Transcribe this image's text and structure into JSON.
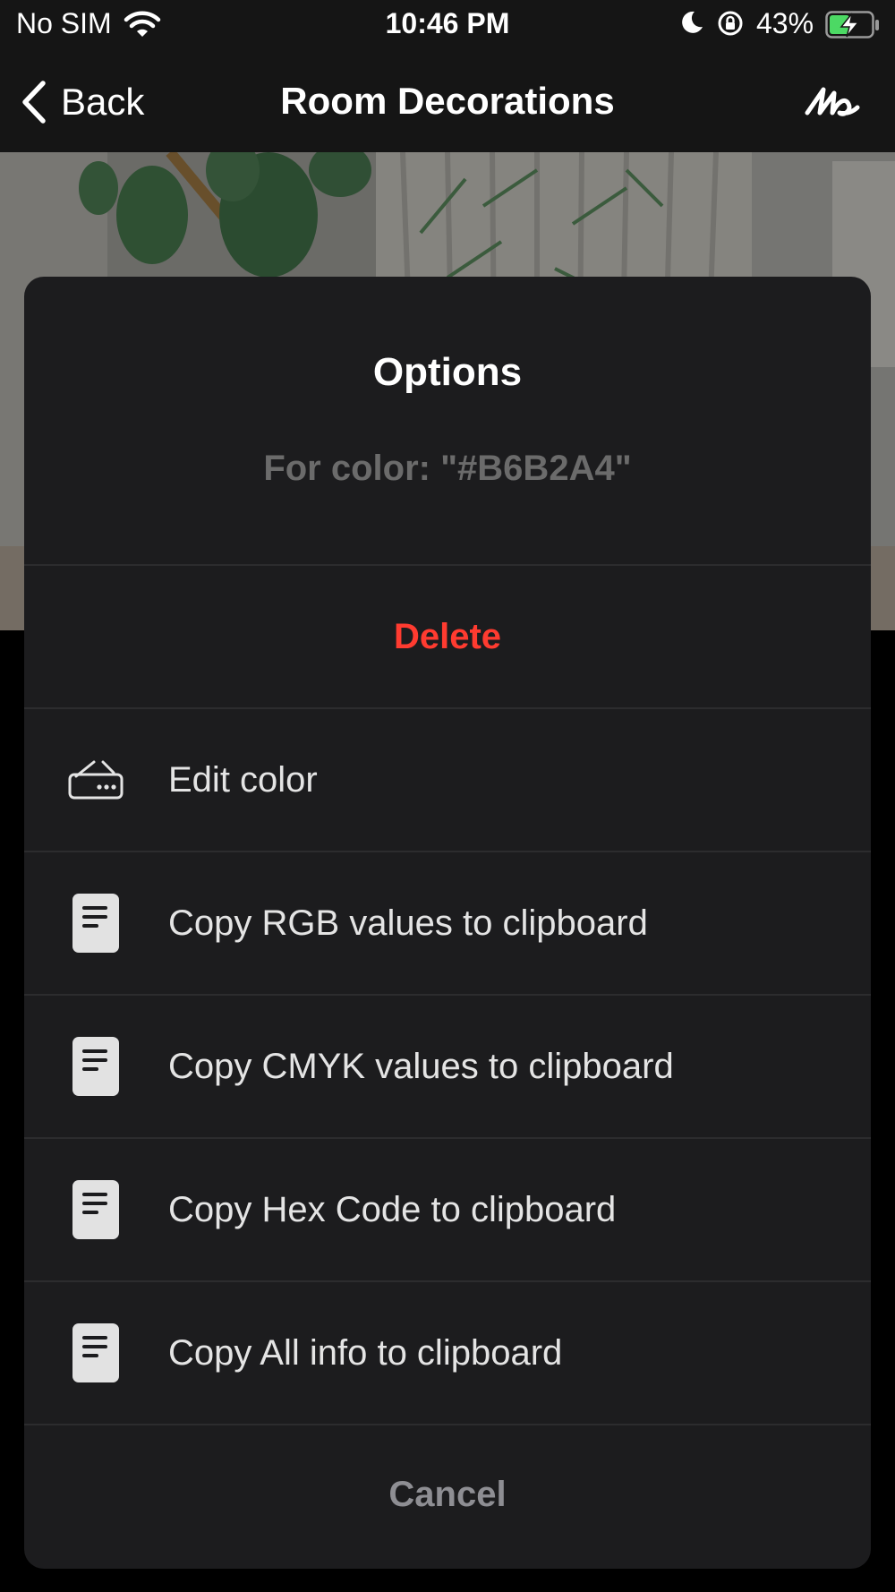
{
  "status_bar": {
    "carrier": "No SIM",
    "time": "10:46 PM",
    "battery_percent": "43%",
    "icons": [
      "wifi-icon",
      "moon-icon",
      "rotation-lock-icon",
      "battery-charging-icon"
    ]
  },
  "nav": {
    "back_label": "Back",
    "title": "Room Decorations",
    "right_icon": "signature-icon"
  },
  "sheet": {
    "title": "Options",
    "subtitle": "For color: \"#B6B2A4\"",
    "delete_label": "Delete",
    "items": [
      {
        "icon": "edit-color-icon",
        "label": "Edit color"
      },
      {
        "icon": "document-icon",
        "label": "Copy RGB values to clipboard"
      },
      {
        "icon": "document-icon",
        "label": "Copy CMYK values to clipboard"
      },
      {
        "icon": "document-icon",
        "label": "Copy Hex Code to clipboard"
      },
      {
        "icon": "document-icon",
        "label": "Copy All info to clipboard"
      }
    ],
    "cancel_label": "Cancel"
  },
  "colors": {
    "destructive": "#FF3B30",
    "sheet_background": "#1C1C1E",
    "battery_fill": "#4CD964"
  }
}
